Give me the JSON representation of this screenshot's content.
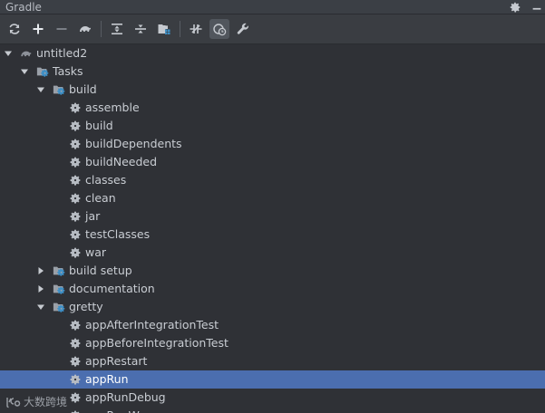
{
  "window": {
    "title": "Gradle"
  },
  "toolbar": {
    "buttons": [
      {
        "name": "refresh-icon"
      },
      {
        "name": "plus-icon"
      },
      {
        "name": "minus-icon"
      },
      {
        "name": "elephant-icon"
      },
      {
        "name": "expand-all-icon"
      },
      {
        "name": "collapse-all-icon"
      },
      {
        "name": "folder-grid-icon"
      },
      {
        "name": "toggle-offline-icon"
      },
      {
        "name": "settings-clock-icon"
      },
      {
        "name": "wrench-icon"
      }
    ]
  },
  "tree": {
    "rows": [
      {
        "label": "untitled2",
        "depth": 0,
        "expanded": true,
        "icon": "elephant-icon"
      },
      {
        "label": "Tasks",
        "depth": 1,
        "expanded": true,
        "icon": "folder-gear-icon"
      },
      {
        "label": "build",
        "depth": 2,
        "expanded": true,
        "icon": "folder-gear-icon"
      },
      {
        "label": "assemble",
        "depth": 3,
        "icon": "gear-icon"
      },
      {
        "label": "build",
        "depth": 3,
        "icon": "gear-icon"
      },
      {
        "label": "buildDependents",
        "depth": 3,
        "icon": "gear-icon"
      },
      {
        "label": "buildNeeded",
        "depth": 3,
        "icon": "gear-icon"
      },
      {
        "label": "classes",
        "depth": 3,
        "icon": "gear-icon"
      },
      {
        "label": "clean",
        "depth": 3,
        "icon": "gear-icon"
      },
      {
        "label": "jar",
        "depth": 3,
        "icon": "gear-icon"
      },
      {
        "label": "testClasses",
        "depth": 3,
        "icon": "gear-icon"
      },
      {
        "label": "war",
        "depth": 3,
        "icon": "gear-icon"
      },
      {
        "label": "build setup",
        "depth": 2,
        "expanded": false,
        "icon": "folder-gear-icon"
      },
      {
        "label": "documentation",
        "depth": 2,
        "expanded": false,
        "icon": "folder-gear-icon"
      },
      {
        "label": "gretty",
        "depth": 2,
        "expanded": true,
        "icon": "folder-gear-icon"
      },
      {
        "label": "appAfterIntegrationTest",
        "depth": 3,
        "icon": "gear-icon"
      },
      {
        "label": "appBeforeIntegrationTest",
        "depth": 3,
        "icon": "gear-icon"
      },
      {
        "label": "appRestart",
        "depth": 3,
        "icon": "gear-icon"
      },
      {
        "label": "appRun",
        "depth": 3,
        "icon": "gear-icon",
        "selected": true
      },
      {
        "label": "appRunDebug",
        "depth": 3,
        "icon": "gear-icon"
      },
      {
        "label": "appRunWar",
        "depth": 3,
        "icon": "gear-icon"
      }
    ]
  },
  "watermark": {
    "text": "大数跨境"
  },
  "colors": {
    "selection": "#4b6eaf",
    "background": "#2f3136",
    "text": "#c9cdd3",
    "icon_gray": "#aeb3ba",
    "folder_blue": "#3d8fc6"
  }
}
